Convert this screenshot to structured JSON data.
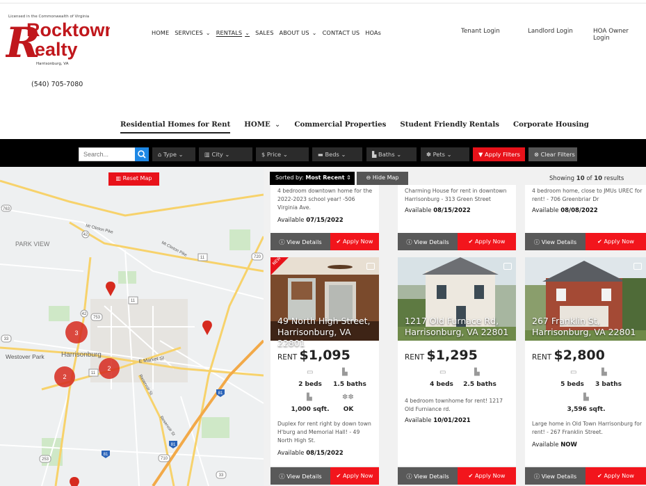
{
  "header": {
    "license": "Licensed in the Commonwealth of Virginia",
    "logo_line1": "Rocktown",
    "logo_line2": "ealty",
    "logo_initial": "R",
    "logo_city": "Harrisonburg, VA",
    "phone": "(540) 705-7080"
  },
  "nav": {
    "home": "HOME",
    "services": "SERVICES",
    "rentals": "RENTALS",
    "sales": "SALES",
    "about": "ABOUT US",
    "contact": "CONTACT US",
    "hoas": "HOAs",
    "chevron": "⌄"
  },
  "logins": {
    "tenant": "Tenant Login",
    "landlord": "Landlord Login",
    "hoa": "HOA Owner Login"
  },
  "subnav": {
    "residential": "Residential Homes for Rent",
    "home": "HOME",
    "commercial": "Commercial Properties",
    "student": "Student Friendly Rentals",
    "corporate": "Corporate Housing"
  },
  "filters": {
    "search_placeholder": "Search...",
    "type": "Type",
    "city": "City",
    "price": "Price",
    "beds": "Beds",
    "baths": "Baths",
    "pets": "Pets",
    "apply": "Apply Filters",
    "clear": "Clear Filters"
  },
  "map": {
    "reset": "Reset Map",
    "labels": {
      "park_view": "PARK VIEW",
      "westover": "Westover Park",
      "harrisonburg": "Harrisonburg",
      "mt_clinton": "Mt Clinton Pike",
      "mt_clinton2": "Mt Clinton Pike",
      "e_market": "E Market St",
      "reservoir": "Reservoir St",
      "reservoir2": "Reservoir St"
    },
    "route_numbers": [
      "763",
      "42",
      "11",
      "720",
      "753",
      "33",
      "42",
      "11",
      "81",
      "253",
      "710",
      "33",
      "81",
      "33",
      "33"
    ],
    "clusters": [
      {
        "count": "3"
      },
      {
        "count": "2"
      },
      {
        "count": "2"
      }
    ]
  },
  "listing_toolbar": {
    "sort_prefix": "Sorted by:",
    "sort_value": "Most Recent",
    "hide_map": "Hide Map",
    "showing_prefix": "Showing",
    "showing_count": "10",
    "showing_of": "of",
    "showing_total": "10",
    "showing_suffix": "results"
  },
  "top_cards": [
    {
      "text": "4 bedroom downtown home for the 2022-2023 school year! -506 Virginia Ave.",
      "avail_label": "Available",
      "avail_date": "07/15/2022"
    },
    {
      "text": "Charming House for rent in downtown Harrisonburg - 313 Green Street",
      "avail_label": "Available",
      "avail_date": "08/15/2022"
    },
    {
      "text": "4 bedroom home, close to JMUs UREC for rent! - 706 Greenbriar Dr",
      "avail_label": "Available",
      "avail_date": "08/08/2022"
    }
  ],
  "buttons": {
    "details": "View Details",
    "apply": "Apply Now"
  },
  "cards": [
    {
      "new_label": "NEW",
      "addr1": "49 North High Street,",
      "addr2": "Harrisonburg, VA 22801",
      "rent_label": "RENT",
      "rent": "$1,095",
      "beds": "2 beds",
      "baths": "1.5 baths",
      "sqft": "1,000 sqft.",
      "pets": "OK",
      "text": "Duplex for rent right by down town H'burg and Memorial Hall! - 49 North High St.",
      "avail_label": "Available",
      "avail_date": "08/15/2022"
    },
    {
      "addr1": "1217 Old Furnace Rd,",
      "addr2": "Harrisonburg, VA 22801",
      "rent_label": "RENT",
      "rent": "$1,295",
      "beds": "4 beds",
      "baths": "2.5 baths",
      "text": "4 bedroom townhome for rent! 1217 Old Furniance rd.",
      "avail_label": "Available",
      "avail_date": "10/01/2021"
    },
    {
      "addr1": "267 Franklin St,",
      "addr2": "Harrisonburg, VA 22801",
      "rent_label": "RENT",
      "rent": "$2,800",
      "beds": "5 beds",
      "baths": "3 baths",
      "sqft": "3,596 sqft.",
      "text": "Large home in Old Town Harrisonburg for rent! - 267 Franklin Street.",
      "avail_label": "Available",
      "avail_date": "NOW"
    }
  ],
  "colors": {
    "accent_red": "#e8121a",
    "filter_bar": "#000000",
    "search_button": "#1e88e5",
    "details_button": "#595959"
  }
}
